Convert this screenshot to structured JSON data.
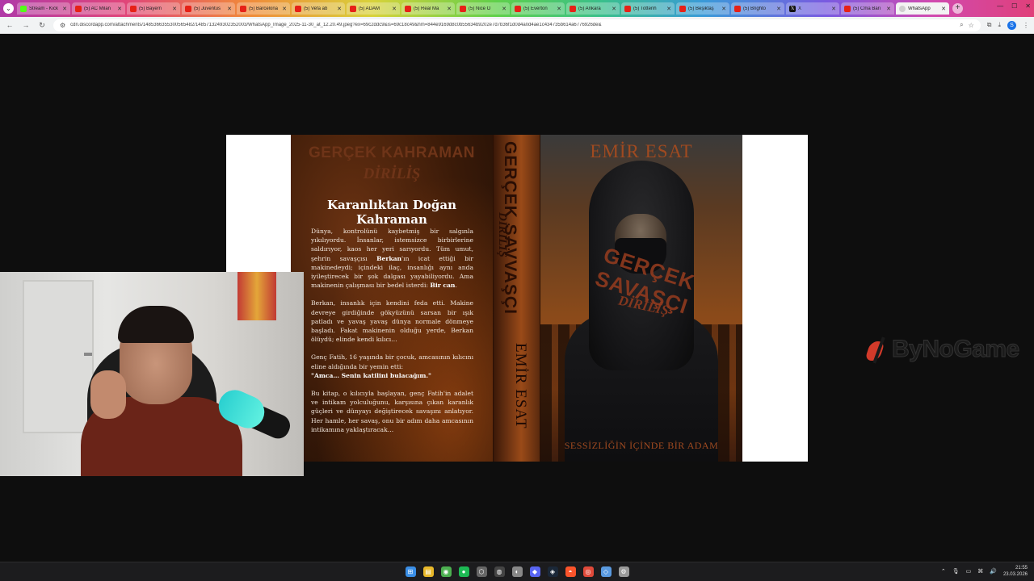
{
  "browser": {
    "tabs": [
      {
        "title": "Stream - Kick",
        "icon": "kick",
        "active": false
      },
      {
        "title": "(5) AC Milan",
        "icon": "yt",
        "active": false
      },
      {
        "title": "(5) Bayern",
        "icon": "yt",
        "active": false
      },
      {
        "title": "(5) Juventus",
        "icon": "yt",
        "active": false
      },
      {
        "title": "(5) Barcelona",
        "icon": "yt",
        "active": false
      },
      {
        "title": "(5) Vefa ab",
        "icon": "yt",
        "active": false
      },
      {
        "title": "(5) ADAM",
        "icon": "yt",
        "active": false
      },
      {
        "title": "(5) Real Ma",
        "icon": "yt",
        "active": false
      },
      {
        "title": "(5) Nice O",
        "icon": "yt",
        "active": false
      },
      {
        "title": "(5) Everton",
        "icon": "yt",
        "active": false
      },
      {
        "title": "(5) Ankara",
        "icon": "yt",
        "active": false
      },
      {
        "title": "(5) Tottenh",
        "icon": "yt",
        "active": false
      },
      {
        "title": "(5) Beşiktaş",
        "icon": "yt",
        "active": false
      },
      {
        "title": "(5) Brighto",
        "icon": "yt",
        "active": false
      },
      {
        "title": "X",
        "icon": "x",
        "active": false
      },
      {
        "title": "(5) Cma Bari",
        "icon": "yt",
        "active": false
      },
      {
        "title": "WhatsApp",
        "icon": "generic",
        "active": true
      }
    ],
    "url": "cdn.discordapp.com/attachments/1485366355300565482/1485713249302352003/WhatsApp_Image_2025-11-30_at_12.20.49.jpeg?ex=69c2ddc9&is=69c18c49&hm=844e9169d8c0b55634b9202e7d7b36f1d0d4a0d4ae1c434735b614a6776926de&"
  },
  "cover": {
    "back_title": "GERÇEK KAHRAMAN",
    "back_subtitle": "DİRİLİŞ",
    "back_heading": "Karanlıktan Doğan Kahraman",
    "spine_title": "GERÇEK SAVVAŞÇI",
    "spine_subtitle": "DİRİLİŞ",
    "spine_author": "EMİR ESAT",
    "front_author": "EMİR ESAT",
    "front_title": "GERÇEK SAVAŞÇI",
    "front_subtitle": "DİRİLİŞ",
    "front_tagline": "SESSİZLİĞİN İÇİNDE BİR ADAM",
    "paragraphs": {
      "p1_a": "Dünya, kontrolünü kaybetmiş bir salgınla yıkılıyordu. İnsanlar, istemsizce birbirlerine saldırıyor, kaos her yeri sarıyordu. Tüm umut, şehrin savaşçısı ",
      "p1_b": "Berkan",
      "p1_c": "'ın icat ettiği bir makinedeydi; içindeki ilaç, insanlığı aynı anda iyileştirecek bir şok dalgası yayabiliyordu. Ama makinenin çalışması bir bedel isterdi: ",
      "p1_d": "Bir can",
      "p1_e": ".",
      "p2": "Berkan, insanlık için kendini feda etti. Makine devreye girdiğinde gökyüzünü sarsan bir ışık patladı ve yavaş yavaş dünya normale dönmeye başladı. Fakat makinenin olduğu yerde, Berkan ölüydü; elinde kendi kılıcı…",
      "p3_a": "Genç Fatih, 16 yaşında bir çocuk, amcasının kılıcını eline aldığında bir yemin etti:",
      "p3_b": "\"Amca… Senin katilini bulacağım.\"",
      "p4": "Bu kitap, o kılıcıyla başlayan, genç Fatih'in adalet ve intikam yolculuğunu, karşısına çıkan karanlık güçleri ve dünyayı değiştirecek savaşını anlatıyor. Her hamle, her savaş, onu bir adım daha amcasının intikamına yaklaştıracak…"
    }
  },
  "watermark": {
    "text": "ByNoGame"
  },
  "taskbar": {
    "icons": [
      "windows-start-icon",
      "file-explorer-icon",
      "chrome-icon",
      "spotify-icon",
      "settings-hex-icon",
      "obs-icon",
      "github-icon",
      "discord-icon",
      "steam-icon",
      "brave-icon",
      "app-icon",
      "network-icon",
      "gear-icon"
    ],
    "time": "21:55",
    "date": "23.03.2026"
  }
}
